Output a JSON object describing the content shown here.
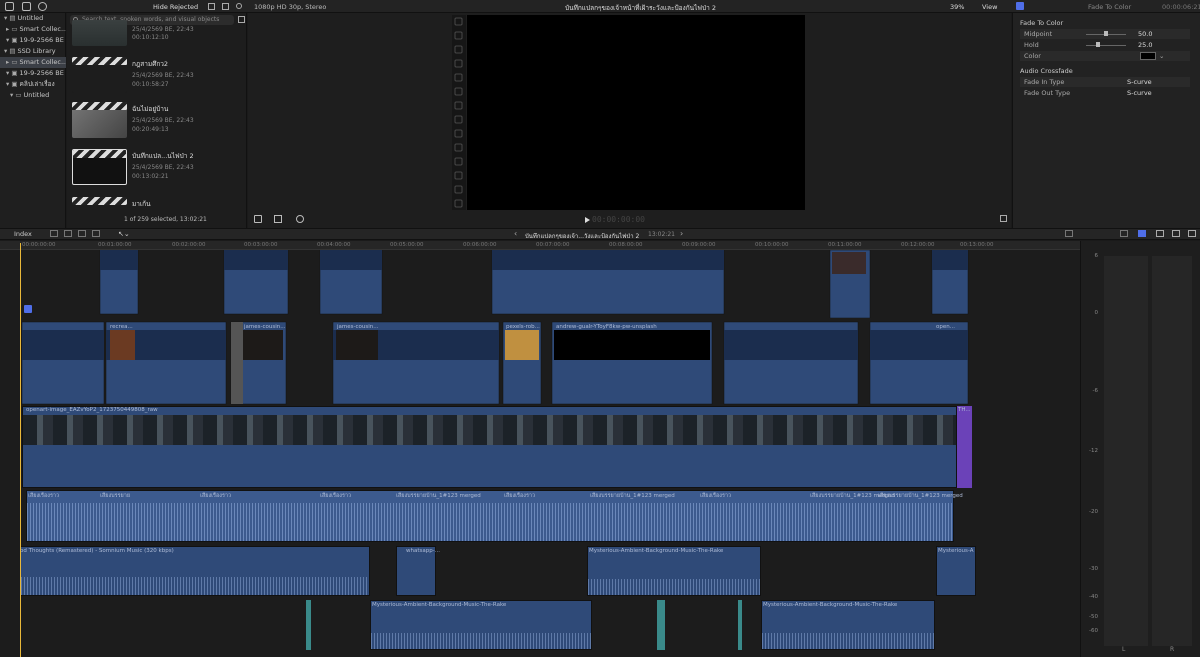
{
  "library": {
    "items": [
      {
        "label": "Untitled",
        "selected": false
      },
      {
        "label": "Smart Collec...",
        "selected": false
      },
      {
        "label": "19-9-2566 BE",
        "selected": false
      },
      {
        "label": "SSD Library",
        "selected": false
      },
      {
        "label": "Smart Collec...",
        "selected": true
      },
      {
        "label": "19-9-2566 BE",
        "selected": false
      },
      {
        "label": "คลิปเล่าเรื่อง",
        "selected": false
      },
      {
        "label": "Untitled",
        "selected": false
      }
    ]
  },
  "browser": {
    "filter_label": "Hide Rejected",
    "search_placeholder": "Search text, spoken words, and visual objects",
    "items": [
      {
        "title": "",
        "date": "25/4/2569 BE, 22:43",
        "duration": "00:10:12:10"
      },
      {
        "title": "กฎสามศึกว2",
        "date": "25/4/2569 BE, 22:43",
        "duration": "00:10:58:27"
      },
      {
        "title": "ฉันไม่อยู่บ้าน",
        "date": "25/4/2569 BE, 22:43",
        "duration": "00:20:49:13"
      },
      {
        "title": "บันทึกแปล...นไฟป่า 2",
        "date": "25/4/2569 BE, 22:43",
        "duration": "00:13:02:21"
      },
      {
        "title": "มาเก้น",
        "date": "",
        "duration": ""
      }
    ],
    "status": "1 of 259 selected, 13:02:21"
  },
  "viewer": {
    "format": "1080p HD 30p, Stereo",
    "title": "บันทึกแปลกๆของเจ้าหน้าที่เฝ้าระวังและป้องกันไฟป่า 2",
    "zoom": "39%",
    "view_label": "View",
    "timecode": "00:00:00:00"
  },
  "inspector": {
    "title": "Fade To Color",
    "duration": "00:00:06:21",
    "section1": "Fade To Color",
    "midpoint_label": "Midpoint",
    "midpoint_value": "50.0",
    "hold_label": "Hold",
    "hold_value": "25.0",
    "color_label": "Color",
    "section2": "Audio Crossfade",
    "fade_in_label": "Fade In Type",
    "fade_in_value": "S-curve",
    "fade_out_label": "Fade Out Type",
    "fade_out_value": "S-curve"
  },
  "timeline": {
    "index_label": "Index",
    "project_name": "บันทึกแปลกๆของเจ้า...วังและป้องกันไฟป่า 2",
    "duration": "13:02:21",
    "ruler": [
      "00:00:00:00",
      "00:01:00:00",
      "00:02:00:00",
      "00:03:00:00",
      "00:04:00:00",
      "00:05:00:00",
      "00:06:00:00",
      "00:07:00:00",
      "00:08:00:00",
      "00:09:00:00",
      "00:10:00:00",
      "00:11:00:00",
      "00:12:00:00",
      "00:13:00:00"
    ],
    "clip_labels": {
      "primary": "openart-image_EAZvYoP2_1723750449808_raw",
      "primary_end": "TH...",
      "v_clips": [
        "recrea...",
        "james-cousin...",
        "james-cousin...",
        "pexels-rob...",
        "andrew-gualr-YToyF8kw-pw-unsplash",
        "open..."
      ],
      "voice": [
        "เสียงเรื่องราว",
        "เสียงบรรยาย",
        "เสียงเรื่องราว",
        "เสียงเรื่องราว",
        "เสียงบรรยายบ้าน_1#123 merged",
        "เสียงเรื่องราว",
        "เสียงบรรยายบ้าน_1#123 merged",
        "เสียงเรื่องราว",
        "เสียงบรรยายบ้าน_1#123 merged",
        "เสียงบรรยายบ้าน_1#123 merged"
      ],
      "music1": "od Thoughts (Remastered) - Somnium Music (320 kbps)",
      "music2": "whatsapp-...",
      "music3": "Mysterious-Ambient-Background-Music-The-Rake",
      "music4": "Mysterious-A...",
      "music5": "Mysterious-Ambient-Background-Music-The-Rake",
      "music6": "Mysterious-Ambient-Background-Music-The-Rake"
    }
  },
  "meters": {
    "scale": [
      "6",
      "0",
      "-6",
      "-12",
      "-20",
      "-30",
      "-40",
      "-50",
      "-60"
    ],
    "left": "L",
    "right": "R"
  },
  "colors": {
    "accent": "#4f6ee8",
    "clip_blue": "#2f4a78",
    "audio_blue": "#3c5a8e",
    "playhead": "#e8b83a",
    "purple": "#6b42b8"
  }
}
